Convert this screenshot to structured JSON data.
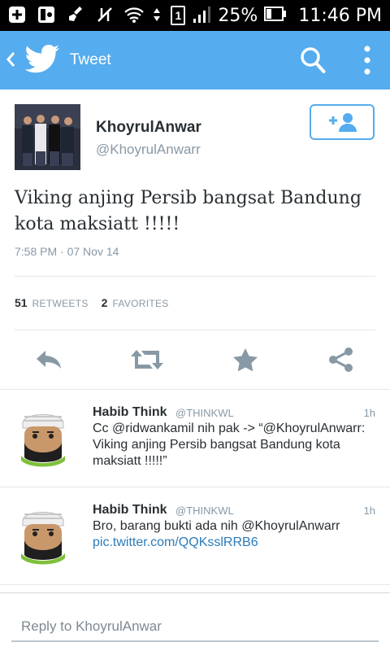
{
  "status_bar": {
    "battery_percent": "25%",
    "time": "11:46 PM",
    "sim_slot": "1"
  },
  "action_bar": {
    "title": "Tweet"
  },
  "tweet": {
    "display_name": "KhoyrulAnwar",
    "screen_name": "@KhoyrulAnwarr",
    "text": "Viking anjing Persib bangsat Bandung kota maksiatt !!!!!",
    "timestamp": "7:58 PM · 07 Nov 14",
    "retweets_count": "51",
    "retweets_label": "RETWEETS",
    "favorites_count": "2",
    "favorites_label": "FAVORITES"
  },
  "replies": [
    {
      "name": "Habib Think",
      "handle": "@THINKWL",
      "time": "1h",
      "text": "Cc @ridwankamil nih pak -> “@KhoyrulAnwarr: Viking anjing Persib bangsat Bandung kota maksiatt !!!!!”"
    },
    {
      "name": "Habib Think",
      "handle": "@THINKWL",
      "time": "1h",
      "text": "Bro, barang bukti ada nih @KhoyrulAnwarr",
      "link": "pic.twitter.com/QQKsslRRB6"
    }
  ],
  "composer": {
    "placeholder": "Reply to KhoyrulAnwar"
  },
  "colors": {
    "brand": "#55acee",
    "text": "#292f33",
    "muted": "#8899a6",
    "link": "#2b7bb9",
    "action_icon": "#8899a6"
  },
  "icons": {
    "back": "chevron-left-icon",
    "logo": "twitter-bird-icon",
    "search": "search-icon",
    "more": "overflow-menu-icon",
    "follow": "add-user-icon",
    "reply": "reply-icon",
    "retweet": "retweet-icon",
    "favorite": "star-icon",
    "share": "share-icon"
  }
}
